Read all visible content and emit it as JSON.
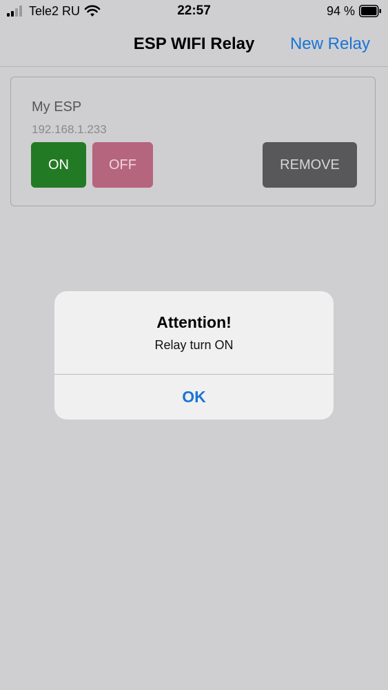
{
  "status_bar": {
    "carrier": "Tele2 RU",
    "time": "22:57",
    "battery": "94 %",
    "icons": [
      "signal-icon",
      "wifi-icon",
      "battery-icon"
    ]
  },
  "nav": {
    "title": "ESP WIFI Relay",
    "action_label": "New Relay"
  },
  "relay": {
    "name": "My ESP",
    "ip": "192.168.1.233",
    "on_label": "ON",
    "off_label": "OFF",
    "remove_label": "REMOVE"
  },
  "alert": {
    "title": "Attention!",
    "message": "Relay turn ON",
    "button_label": "OK"
  },
  "colors": {
    "background": "#cfcfd1",
    "accent": "#1a74d6",
    "on_button": "#237a24",
    "off_button": "#b6657f",
    "remove_button": "#58585b"
  }
}
